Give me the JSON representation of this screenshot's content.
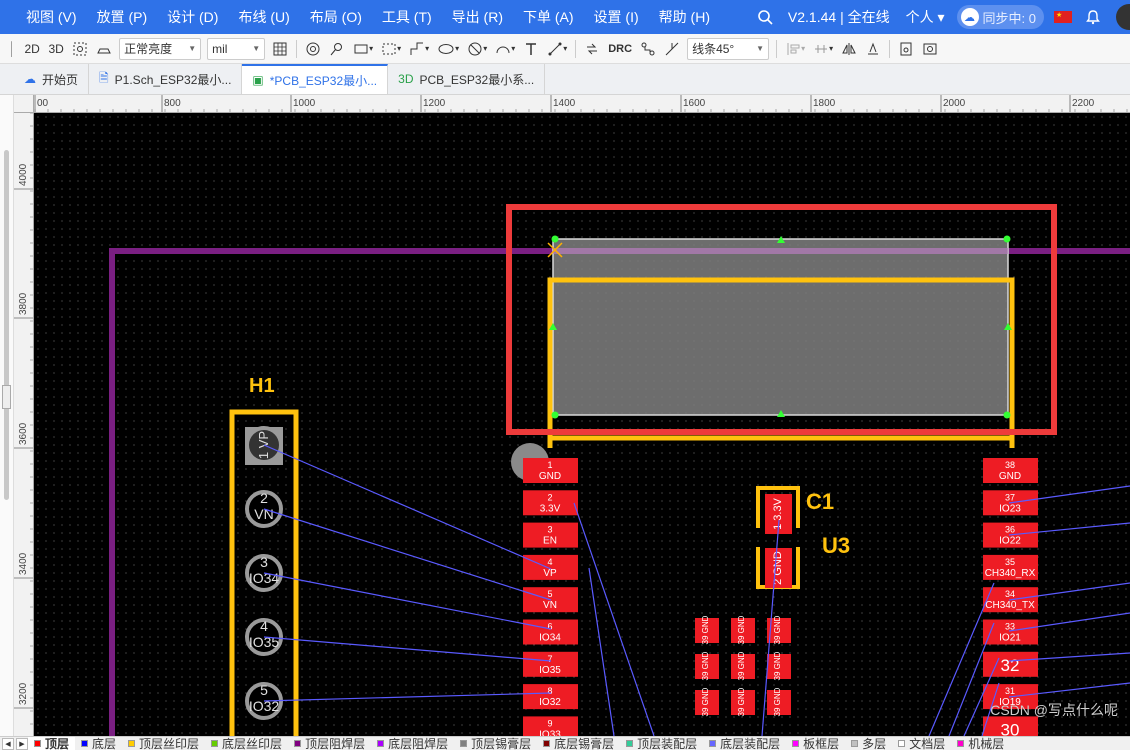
{
  "menu": [
    "视图 (V)",
    "放置 (P)",
    "设计 (D)",
    "布线 (U)",
    "布局 (O)",
    "工具 (T)",
    "导出 (R)",
    "下单 (A)",
    "设置 (I)",
    "帮助 (H)"
  ],
  "header": {
    "search_icon": "search-icon",
    "version": "V2.1.44 | 全在线",
    "user": "个人",
    "sync_label": "同步中: 0",
    "language_flag": "cn-flag-icon",
    "bell_icon": "bell-icon"
  },
  "toolbar": {
    "view_2d": "2D",
    "view_3d": "3D",
    "brightness": "正常亮度",
    "unit": "mil",
    "drc": "DRC",
    "route_mode": "线条45°"
  },
  "tabs": [
    {
      "icon": "cloud-icon",
      "label": "开始页",
      "active": false
    },
    {
      "icon": "schematic-icon",
      "label": "P1.Sch_ESP32最小...",
      "active": false
    },
    {
      "icon": "pcb-icon",
      "label": "*PCB_ESP32最小...",
      "active": true
    },
    {
      "icon": "3d-icon",
      "label": "PCB_ESP32最小系...",
      "active": false
    }
  ],
  "rulers": {
    "horizontal": [
      {
        "label": "00"
      },
      {
        "label": "800"
      },
      {
        "label": "1000"
      },
      {
        "label": "1200"
      },
      {
        "label": "1400"
      },
      {
        "label": "1600"
      },
      {
        "label": "1800"
      },
      {
        "label": "2000"
      },
      {
        "label": "2200"
      }
    ],
    "vertical": [
      {
        "label": "4000"
      },
      {
        "label": "3800"
      },
      {
        "label": "3600"
      },
      {
        "label": "3400"
      },
      {
        "label": "3200"
      }
    ]
  },
  "pcb": {
    "designators": {
      "h1": "H1",
      "c1": "C1",
      "u3": "U3"
    },
    "h1_pins": [
      {
        "num": "1",
        "name": "VP"
      },
      {
        "num": "2",
        "name": "VN"
      },
      {
        "num": "3",
        "name": "IO34"
      },
      {
        "num": "4",
        "name": "IO35"
      },
      {
        "num": "5",
        "name": "IO32"
      }
    ],
    "u3_left_pins": [
      {
        "num": "1",
        "name": "GND"
      },
      {
        "num": "2",
        "name": "3.3V"
      },
      {
        "num": "3",
        "name": "EN"
      },
      {
        "num": "4",
        "name": "VP"
      },
      {
        "num": "5",
        "name": "VN"
      },
      {
        "num": "6",
        "name": "IO34"
      },
      {
        "num": "7",
        "name": "IO35"
      },
      {
        "num": "8",
        "name": "IO32"
      },
      {
        "num": "9",
        "name": "IO33"
      }
    ],
    "u3_right_pins": [
      {
        "num": "38",
        "name": "GND"
      },
      {
        "num": "37",
        "name": "IO23"
      },
      {
        "num": "36",
        "name": "IO22"
      },
      {
        "num": "35",
        "name": "CH340_RX"
      },
      {
        "num": "34",
        "name": "CH340_TX"
      },
      {
        "num": "33",
        "name": "IO21"
      },
      {
        "num": "32",
        "name": ""
      },
      {
        "num": "31",
        "name": "IO19"
      },
      {
        "num": "30",
        "name": ""
      }
    ],
    "gnd_pad": {
      "num": "39",
      "name": "GND"
    },
    "c1_pins": [
      {
        "num": "1",
        "name": "3.3V"
      },
      {
        "num": "2",
        "name": "GND"
      }
    ]
  },
  "layers": [
    {
      "label": "顶层",
      "color": "#ff0000",
      "active": true
    },
    {
      "label": "底层",
      "color": "#0000ff",
      "active": false
    },
    {
      "label": "顶层丝印层",
      "color": "#ffcc00",
      "active": false
    },
    {
      "label": "底层丝印层",
      "color": "#66cc00",
      "active": false
    },
    {
      "label": "顶层阻焊层",
      "color": "#800080",
      "active": false
    },
    {
      "label": "底层阻焊层",
      "color": "#aa00ff",
      "active": false
    },
    {
      "label": "顶层锡膏层",
      "color": "#808080",
      "active": false
    },
    {
      "label": "底层锡膏层",
      "color": "#800000",
      "active": false
    },
    {
      "label": "顶层装配层",
      "color": "#33cc99",
      "active": false
    },
    {
      "label": "底层装配层",
      "color": "#6666ff",
      "active": false
    },
    {
      "label": "板框层",
      "color": "#ff00ff",
      "active": false
    },
    {
      "label": "多层",
      "color": "#c0c0c0",
      "active": false
    },
    {
      "label": "文档层",
      "color": "#ffffff",
      "active": false
    },
    {
      "label": "机械层",
      "color": "#ff00cc",
      "active": false
    }
  ],
  "watermark": "CSDN @写点什么呢"
}
